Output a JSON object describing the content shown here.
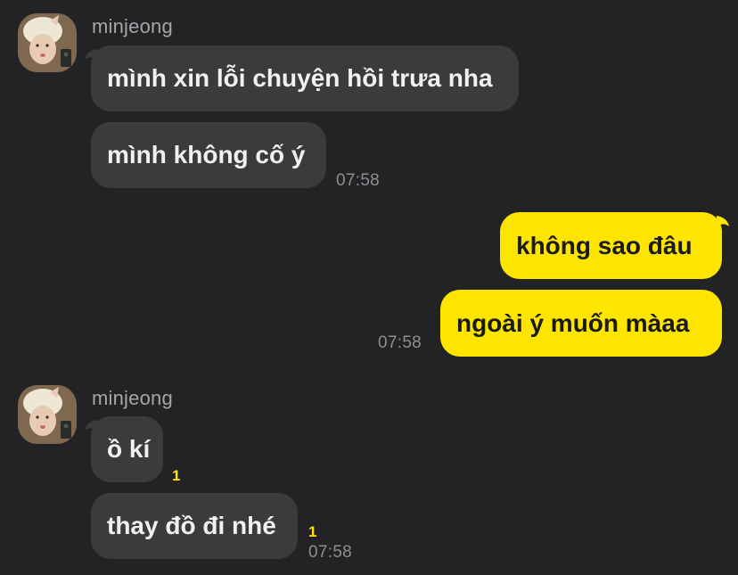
{
  "colors": {
    "background": "#232325",
    "incoming_bubble": "#3b3b3d",
    "outgoing_bubble": "#fee500",
    "sender_name": "#a6a6aa",
    "timestamp": "#8e8e93",
    "unread_count": "#fee500"
  },
  "groups": [
    {
      "sender": "minjeong",
      "messages": [
        "mình xin lỗi chuyện hồi trưa nha",
        "mình không cố ý"
      ],
      "time": "07:58"
    },
    {
      "sender": "me",
      "messages": [
        "không sao đâu",
        "ngoài ý muốn màaa"
      ],
      "time": "07:58"
    },
    {
      "sender": "minjeong",
      "messages": [
        "ồ kí",
        "thay đồ đi nhé"
      ],
      "unread": [
        "1",
        "1"
      ],
      "time": "07:58"
    }
  ]
}
